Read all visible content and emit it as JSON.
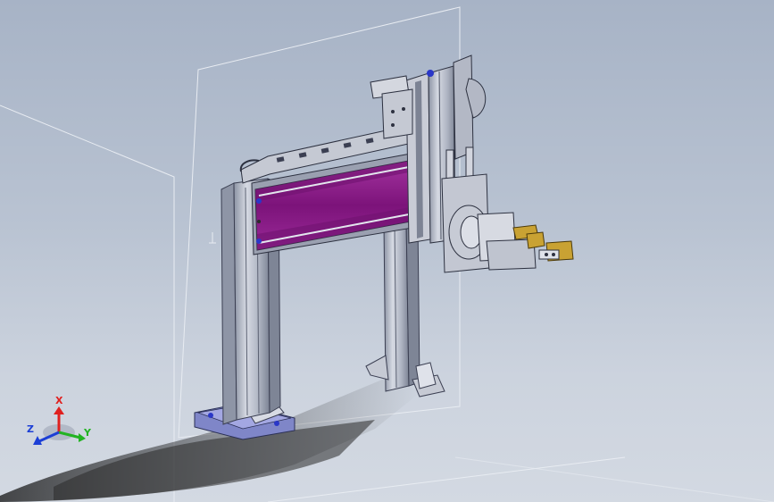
{
  "viewport": {
    "background_top": "#a7b3c6",
    "background_bottom": "#d3d9e2"
  },
  "model": {
    "frame_color": "#b7bcc8",
    "slide_panel_color": "#8e1d8c",
    "gripper_brass_color": "#c9a233",
    "mount_plate_color": "#8e8fd8",
    "screw_head_color": "#2a37c8"
  },
  "triad": {
    "x_label": "X",
    "y_label": "Y",
    "z_label": "Z",
    "x_color": "#e0201f",
    "y_color": "#22b322",
    "z_color": "#1c3fd6"
  }
}
